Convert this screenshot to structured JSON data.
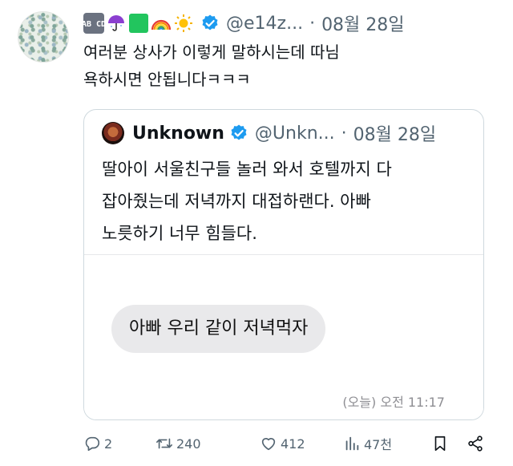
{
  "author": {
    "emoji_badge_text": "AB CD",
    "emojis": [
      "abcd-emoji",
      "umbrella-emoji",
      "green-square-emoji",
      "rainbow-emoji",
      "sun-emoji"
    ],
    "handle": "@e14z...",
    "separator": "·",
    "date": "08월 28일"
  },
  "tweet": {
    "line1": "여러분 상사가 이렇게 말하시는데 따님",
    "line2": "욕하시면 안됩니다ㅋㅋㅋ"
  },
  "quote": {
    "name": "Unknown",
    "handle": "@Unkn...",
    "separator": "·",
    "date": "08월 28일",
    "text_line1": "딸아이 서울친구들 놀러 와서 호텔까지 다",
    "text_line2": "잡아줬는데 저녁까지 대접하랜다. 아빠",
    "text_line3": "노릇하기 너무 힘들다.",
    "message_bubble": "아빠 우리 같이 저녁먹자",
    "message_time": "(오늘) 오전 11:17"
  },
  "actions": {
    "replies": "2",
    "retweets": "240",
    "likes": "412",
    "views": "47천"
  },
  "colors": {
    "verified": "#1d9bf0",
    "muted": "#536471",
    "border": "#cfd9de",
    "bubble": "#e9e9eb"
  }
}
